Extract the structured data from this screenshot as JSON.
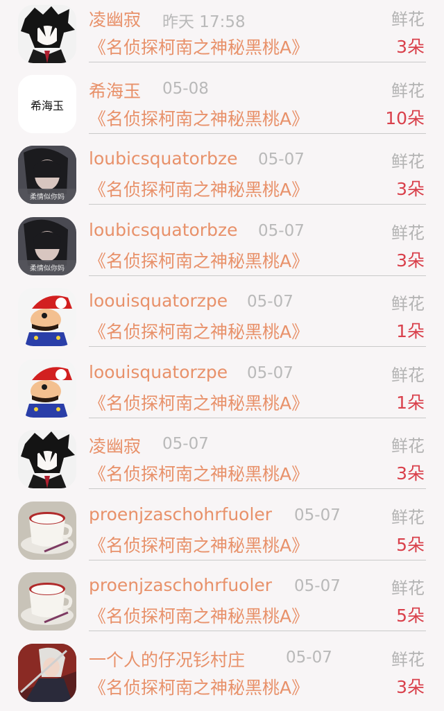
{
  "rows": [
    {
      "name": "凌幽寂",
      "date": "昨天 17:58",
      "book": "《名侦探柯南之神秘黑桃A》",
      "gift_label": "鲜花",
      "gift_count": "3朵",
      "avatar": "avatar-anime-boy"
    },
    {
      "name": "希海玉",
      "date": "05-08",
      "book": "《名侦探柯南之神秘黑桃A》",
      "gift_label": "鲜花",
      "gift_count": "10朵",
      "avatar": "avatar-calligraphy",
      "avatar_text": "希海玉"
    },
    {
      "name": "loubicsquatorbze",
      "date": "05-07",
      "book": "《名侦探柯南之神秘黑桃A》",
      "gift_label": "鲜花",
      "gift_count": "3朵",
      "avatar": "avatar-girl-photo",
      "avatar_text": "柔情似你妈"
    },
    {
      "name": "loubicsquatorbze",
      "date": "05-07",
      "book": "《名侦探柯南之神秘黑桃A》",
      "gift_label": "鲜花",
      "gift_count": "3朵",
      "avatar": "avatar-girl-photo",
      "avatar_text": "柔情似你妈"
    },
    {
      "name": "loouisquatorzpe",
      "date": "05-07",
      "book": "《名侦探柯南之神秘黑桃A》",
      "gift_label": "鲜花",
      "gift_count": "1朵",
      "avatar": "avatar-mario"
    },
    {
      "name": "loouisquatorzpe",
      "date": "05-07",
      "book": "《名侦探柯南之神秘黑桃A》",
      "gift_label": "鲜花",
      "gift_count": "1朵",
      "avatar": "avatar-mario"
    },
    {
      "name": "凌幽寂",
      "date": "05-07",
      "book": "《名侦探柯南之神秘黑桃A》",
      "gift_label": "鲜花",
      "gift_count": "3朵",
      "avatar": "avatar-anime-boy"
    },
    {
      "name": "proenjzaschohrfuoler",
      "date": "05-07",
      "book": "《名侦探柯南之神秘黑桃A》",
      "gift_label": "鲜花",
      "gift_count": "5朵",
      "avatar": "avatar-coffee-cup"
    },
    {
      "name": "proenjzaschohrfuoler",
      "date": "05-07",
      "book": "《名侦探柯南之神秘黑桃A》",
      "gift_label": "鲜花",
      "gift_count": "5朵",
      "avatar": "avatar-coffee-cup"
    },
    {
      "name": "一个人的仔况钐村庄",
      "date": "05-07",
      "book": "《名侦探柯南之神秘黑桃A》",
      "gift_label": "鲜花",
      "gift_count": "3朵",
      "avatar": "avatar-anime-warrior"
    }
  ],
  "colors": {
    "name": "#e8916a",
    "date": "#b9b9b9",
    "gift_label": "#b3b3b3",
    "gift_count": "#d9404b",
    "background": "#f8f5f6",
    "divider": "#c9c9c9"
  }
}
